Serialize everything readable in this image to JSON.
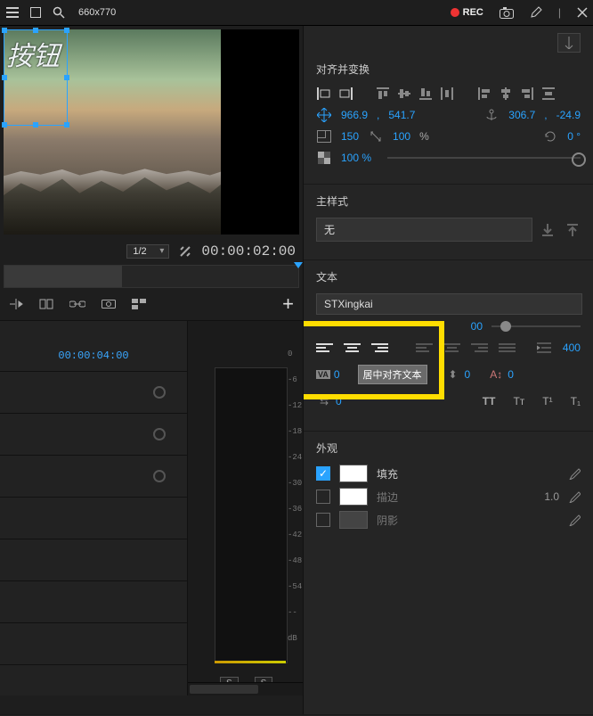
{
  "topbar": {
    "dimensions": "660x770",
    "rec": "REC"
  },
  "preview": {
    "title_text": "按钮",
    "zoom_options": [
      "1/2"
    ],
    "zoom": "1/2",
    "timecode": "00:00:02:00"
  },
  "timeline": {
    "current_time": "00:00:04:00",
    "solo_btn": "S",
    "meter_ticks": [
      "0",
      "-6",
      "-12",
      "-18",
      "-24",
      "-30",
      "-36",
      "-42",
      "-48",
      "-54",
      "--",
      "dB"
    ]
  },
  "panels": {
    "align": {
      "title": "对齐并变换",
      "pos_x": "966.9",
      "pos_y": "541.7",
      "anchor_x": "306.7",
      "anchor_y": "-24.9",
      "scale_w": "150",
      "scale_h": "100",
      "pct": "%",
      "rotation": "0 °",
      "opacity": "100 %"
    },
    "master": {
      "title": "主样式",
      "value": "无"
    },
    "text": {
      "title": "文本",
      "font": "STXingkai",
      "font_size": "00",
      "tracking_lbl": "VA",
      "tracking": "0",
      "tooltip": "居中对齐文本",
      "kerning1": "0",
      "kerning2": "0",
      "kerning3": "0",
      "leading": "0",
      "baseline": "400",
      "typo1": "TT",
      "typo2": "Tт",
      "typo3": "T¹",
      "typo4": "T₁"
    },
    "appearance": {
      "title": "外观",
      "fill": "填充",
      "stroke": "描边",
      "stroke_w": "1.0",
      "shadow": "阴影"
    }
  }
}
